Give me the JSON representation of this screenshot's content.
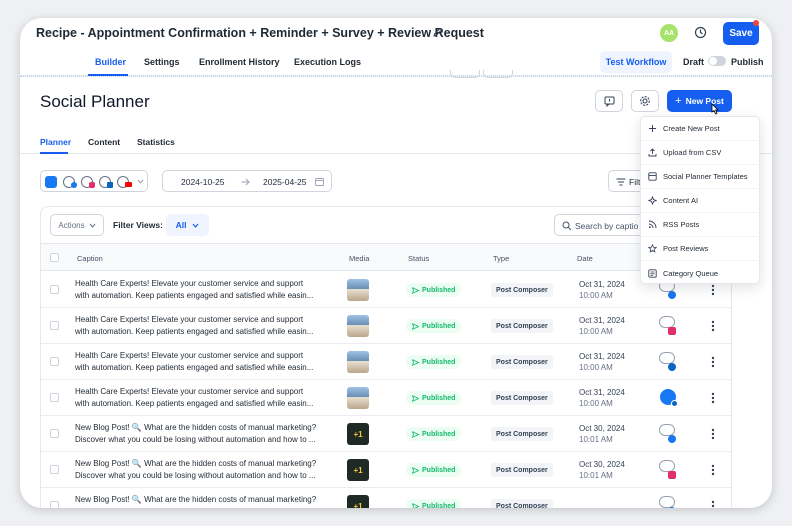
{
  "topbar": {
    "title": "Recipe - Appointment Confirmation + Reminder + Survey + Review Request",
    "avatar_initials": "AA",
    "save_label": "Save"
  },
  "nav": {
    "tabs": [
      "Builder",
      "Settings",
      "Enrollment History",
      "Execution Logs"
    ],
    "active": "Builder",
    "test_workflow_label": "Test Workflow",
    "draft_label": "Draft",
    "publish_label": "Publish"
  },
  "planner": {
    "title": "Social Planner",
    "new_post_label": "New Post",
    "subtabs": [
      "Planner",
      "Content",
      "Statistics"
    ],
    "active_subtab": "Planner",
    "date_from": "2024-10-25",
    "date_to": "2025-04-25",
    "filter_label": "Filt",
    "actions_label": "Actions",
    "filter_views_label": "Filter Views:",
    "filter_views_value": "All",
    "search_placeholder": "Search by captio"
  },
  "table": {
    "headers": [
      "Caption",
      "Media",
      "Status",
      "Type",
      "Date"
    ],
    "rows": [
      {
        "line1": "Health Care Experts! Elevate your customer service and support",
        "line2": "with automation. Keep patients engaged and satisfied while easin...",
        "media": "photo",
        "status": "Published",
        "type": "Post Composer",
        "date": "Oct 31, 2024",
        "time": "10:00 AM",
        "account": "facebook"
      },
      {
        "line1": "Health Care Experts! Elevate your customer service and support",
        "line2": "with automation. Keep patients engaged and satisfied while easin...",
        "media": "photo",
        "status": "Published",
        "type": "Post Composer",
        "date": "Oct 31, 2024",
        "time": "10:00 AM",
        "account": "instagram"
      },
      {
        "line1": "Health Care Experts! Elevate your customer service and support",
        "line2": "with automation. Keep patients engaged and satisfied while easin...",
        "media": "photo",
        "status": "Published",
        "type": "Post Composer",
        "date": "Oct 31, 2024",
        "time": "10:00 AM",
        "account": "linkedin"
      },
      {
        "line1": "Health Care Experts! Elevate your customer service and support",
        "line2": "with automation. Keep patients engaged and satisfied while easin...",
        "media": "photo",
        "status": "Published",
        "type": "Post Composer",
        "date": "Oct 31, 2024",
        "time": "10:00 AM",
        "account": "google"
      },
      {
        "line1": "New Blog Post! 🔍 What are the hidden costs of manual marketing?",
        "line2": "Discover what you could be losing without automation and how to ...",
        "media": "+1",
        "status": "Published",
        "type": "Post Composer",
        "date": "Oct 30, 2024",
        "time": "10:01 AM",
        "account": "facebook"
      },
      {
        "line1": "New Blog Post! 🔍 What are the hidden costs of manual marketing?",
        "line2": "Discover what you could be losing without automation and how to ...",
        "media": "+1",
        "status": "Published",
        "type": "Post Composer",
        "date": "Oct 30, 2024",
        "time": "10:01 AM",
        "account": "instagram"
      },
      {
        "line1": "New Blog Post! 🔍 What are the hidden costs of manual marketing?",
        "line2": "",
        "media": "+1",
        "status": "Published",
        "type": "Post Composer",
        "date": "",
        "time": "",
        "account": "facebook"
      }
    ]
  },
  "dropdown": {
    "items": [
      {
        "label": "Create New Post",
        "icon": "plus-icon"
      },
      {
        "label": "Upload from CSV",
        "icon": "upload-icon"
      },
      {
        "label": "Social Planner Templates",
        "icon": "template-icon"
      },
      {
        "label": "Content AI",
        "icon": "ai-icon"
      },
      {
        "label": "RSS Posts",
        "icon": "rss-icon"
      },
      {
        "label": "Post Reviews",
        "icon": "star-icon"
      },
      {
        "label": "Category Queue",
        "icon": "queue-icon"
      }
    ]
  },
  "colors": {
    "primary": "#155eef",
    "success": "#12b76a",
    "facebook": "#1877f2",
    "instagram": "#e1306c",
    "linkedin": "#0a66c2",
    "youtube": "#ff0000"
  }
}
